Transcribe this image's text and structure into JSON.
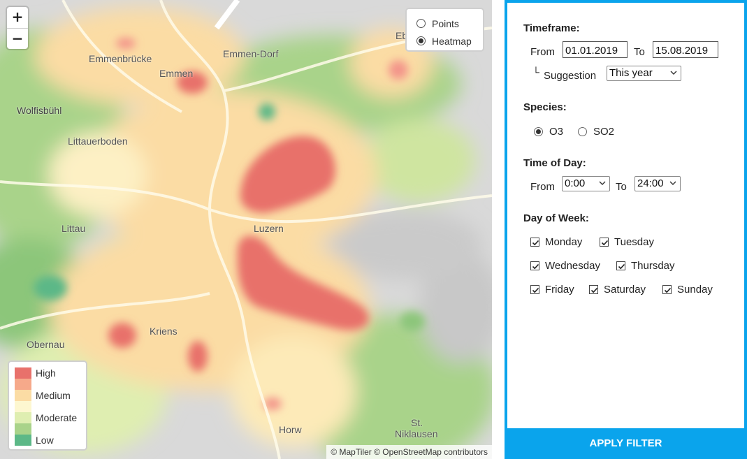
{
  "map": {
    "zoom_in_label": "+",
    "zoom_out_label": "−",
    "layer_options": [
      {
        "label": "Points",
        "selected": false
      },
      {
        "label": "Heatmap",
        "selected": true
      }
    ],
    "places": {
      "emmen_dorf": "Emmen-Dorf",
      "emmenbrucke": "Emmenbrücke",
      "emmen": "Emmen",
      "ebikon": "Eb",
      "wolfisbuhl": "Wolfisbühl",
      "littauerboden": "Littauerboden",
      "littau": "Littau",
      "luzern": "Luzern",
      "kriens": "Kriens",
      "obernau": "Obernau",
      "horw": "Horw",
      "st_niklausen_1": "St.",
      "st_niklausen_2": "Niklausen"
    },
    "legend": [
      {
        "label": "High",
        "color": "#e8716b"
      },
      {
        "label": "",
        "color": "#f6a98a"
      },
      {
        "label": "Medium",
        "color": "#fbdca4"
      },
      {
        "label": "",
        "color": "#fdf7d0"
      },
      {
        "label": "Moderate",
        "color": "#dfeeb1"
      },
      {
        "label": "",
        "color": "#a9d38a"
      },
      {
        "label": "Low",
        "color": "#5cb887"
      }
    ],
    "attribution": "© MapTiler © OpenStreetMap contributors"
  },
  "filter": {
    "timeframe_heading": "Timeframe:",
    "from_label": "From",
    "from_value": "01.01.2019",
    "to_label": "To",
    "to_value": "15.08.2019",
    "suggestion_prefix": "└",
    "suggestion_label": "Suggestion",
    "suggestion_value": "This year",
    "species_heading": "Species:",
    "species_options": [
      {
        "label": "O3",
        "selected": true
      },
      {
        "label": "SO2",
        "selected": false
      }
    ],
    "time_of_day_heading": "Time of Day:",
    "tod_from_label": "From",
    "tod_from_value": "0:00",
    "tod_to_label": "To",
    "tod_to_value": "24:00",
    "day_of_week_heading": "Day of Week:",
    "days": [
      {
        "label": "Monday",
        "checked": true
      },
      {
        "label": "Tuesday",
        "checked": true
      },
      {
        "label": "Wednesday",
        "checked": true
      },
      {
        "label": "Thursday",
        "checked": true
      },
      {
        "label": "Friday",
        "checked": true
      },
      {
        "label": "Saturday",
        "checked": true
      },
      {
        "label": "Sunday",
        "checked": true
      }
    ],
    "apply_label": "APPLY FILTER"
  },
  "colors": {
    "accent": "#0aa4ec"
  }
}
